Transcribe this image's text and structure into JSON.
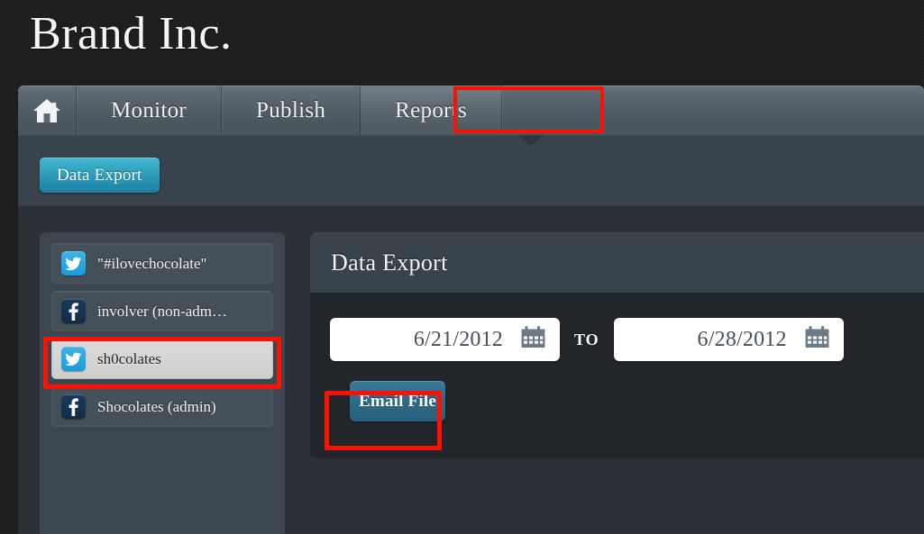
{
  "brand": {
    "title": "Brand Inc."
  },
  "nav": {
    "home_icon": "home-icon",
    "tabs": [
      {
        "label": "Monitor",
        "active": false
      },
      {
        "label": "Publish",
        "active": false
      },
      {
        "label": "Reports",
        "active": true
      }
    ]
  },
  "toolbar": {
    "data_export_label": "Data Export"
  },
  "sidebar": {
    "items": [
      {
        "label": "\"#ilovechocolate\"",
        "network": "twitter",
        "icon": "twitter-bird-icon",
        "selected": false
      },
      {
        "label": "involver (non-adm…",
        "network": "facebook",
        "icon": "facebook-f-icon",
        "selected": false
      },
      {
        "label": "sh0colates",
        "network": "twitter",
        "icon": "twitter-bird-icon",
        "selected": true
      },
      {
        "label": "Shocolates (admin)",
        "network": "facebook",
        "icon": "facebook-f-icon",
        "selected": false
      }
    ]
  },
  "main": {
    "title": "Data Export",
    "date_from": {
      "value": "6/21/2012",
      "icon": "calendar-icon"
    },
    "separator": "TO",
    "date_to": {
      "value": "6/28/2012",
      "icon": "calendar-icon"
    },
    "email_button_label": "Email File"
  },
  "colors": {
    "accent_cyan": "#2ba0bd",
    "accent_steel": "#2e6b88",
    "highlight_red": "#fe1103",
    "panel_dark": "#22262b",
    "panel_slate": "#39434b",
    "page_bg": "#1b1b1c",
    "twitter_blue": "#1a9bd8",
    "facebook_navy": "#112c48"
  }
}
